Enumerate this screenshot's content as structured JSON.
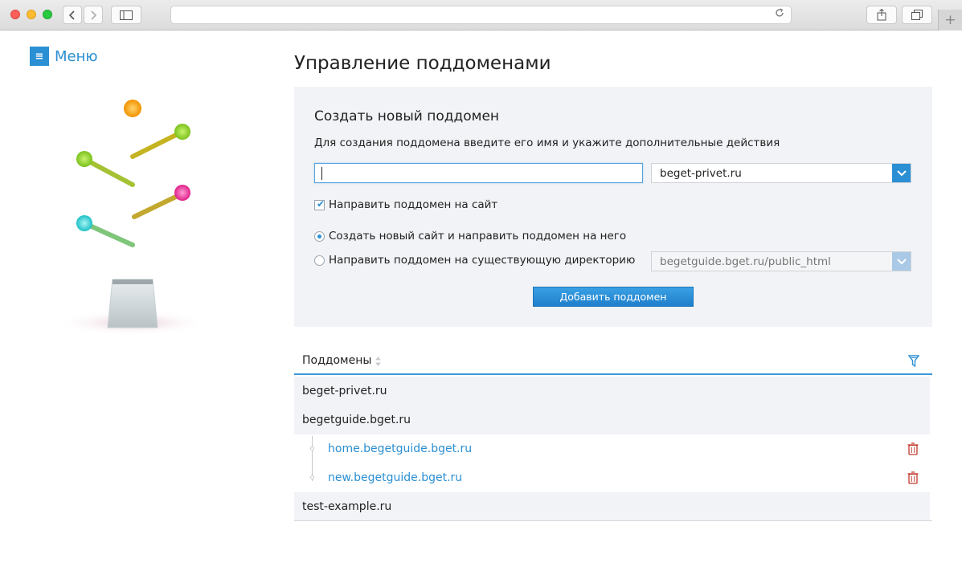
{
  "browser": {
    "new_tab_glyph": "+"
  },
  "sidebar": {
    "menu_label": "Меню",
    "menu_icon_glyph": "≡"
  },
  "main": {
    "title": "Управление поддоменами",
    "form": {
      "title": "Создать новый поддомен",
      "description": "Для создания поддомена введите его имя и укажите дополнительные действия",
      "subdomain_value": "",
      "domain_select_value": "beget-privet.ru",
      "redirect_checkbox_label": "Направить поддомен на сайт",
      "redirect_checked": true,
      "radio_new_site_label": "Создать новый сайт и направить поддомен на него",
      "radio_existing_dir_label": "Направить поддомен на существующую директорию",
      "radio_selected": "new_site",
      "directory_select_value": "begetguide.bget.ru/public_html",
      "submit_label": "Добавить поддомен"
    },
    "table": {
      "column_header": "Поддомены",
      "rows": [
        {
          "label": "beget-privet.ru",
          "kind": "domain"
        },
        {
          "label": "begetguide.bget.ru",
          "kind": "domain"
        },
        {
          "label": "home.begetguide.bget.ru",
          "kind": "subdomain"
        },
        {
          "label": "new.begetguide.bget.ru",
          "kind": "subdomain"
        },
        {
          "label": "test-example.ru",
          "kind": "domain"
        }
      ]
    }
  },
  "colors": {
    "accent": "#2b8fd4",
    "link": "#2a8fd2",
    "delete_icon": "#c0392b",
    "panel_bg": "#f1f3f6"
  },
  "icons": {
    "menu": "hamburger-icon",
    "back": "chevron-left-icon",
    "forward": "chevron-right-icon",
    "sidebar_toggle": "sidebar-icon",
    "reload": "reload-icon",
    "share": "share-icon",
    "tabs": "tabs-icon",
    "sort": "sort-icon",
    "filter": "filter-icon",
    "delete": "trash-icon",
    "dropdown": "chevron-down-icon"
  }
}
